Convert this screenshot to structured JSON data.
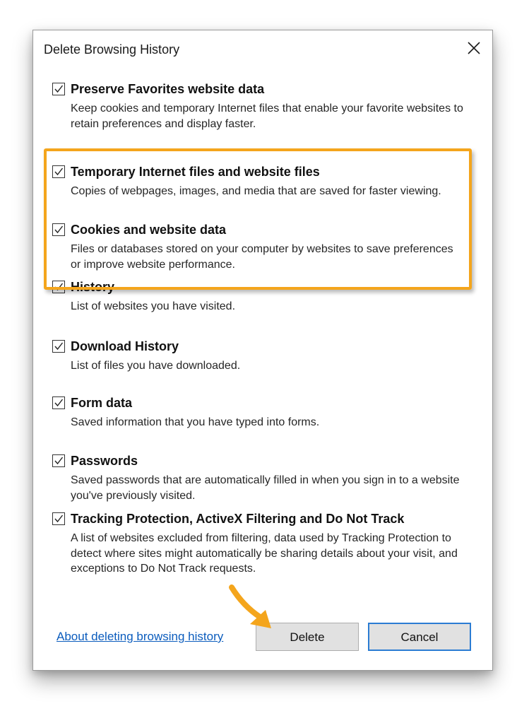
{
  "window": {
    "title": "Delete Browsing History",
    "close_icon": "close-icon"
  },
  "options": [
    {
      "key": "preserve-favorites",
      "label": "Preserve Favorites website data",
      "checked": true,
      "description": "Keep cookies and temporary Internet files that enable your favorite websites to retain preferences and display faster."
    },
    {
      "key": "temporary-internet-files",
      "label": "Temporary Internet files and website files",
      "checked": true,
      "description": "Copies of webpages, images, and media that are saved for faster viewing."
    },
    {
      "key": "cookies",
      "label": "Cookies and website data",
      "checked": true,
      "description": "Files or databases stored on your computer by websites to save preferences or improve website performance."
    },
    {
      "key": "history",
      "label": "History",
      "checked": true,
      "description": "List of websites you have visited."
    },
    {
      "key": "download-history",
      "label": "Download History",
      "checked": true,
      "description": "List of files you have downloaded."
    },
    {
      "key": "form-data",
      "label": "Form data",
      "checked": true,
      "description": "Saved information that you have typed into forms."
    },
    {
      "key": "passwords",
      "label": "Passwords",
      "checked": true,
      "description": "Saved passwords that are automatically filled in when you sign in to a website you've previously visited."
    },
    {
      "key": "tracking-protection",
      "label": "Tracking Protection, ActiveX Filtering and Do Not Track",
      "checked": true,
      "description": "A list of websites excluded from filtering, data used by Tracking Protection to detect where sites might automatically be sharing details about your visit, and exceptions to Do Not Track requests."
    }
  ],
  "footer": {
    "link_text": "About deleting browsing history",
    "delete_label": "Delete",
    "cancel_label": "Cancel"
  },
  "annotations": {
    "highlight_color": "#f4a51c",
    "arrow_color": "#f4a51c"
  },
  "colors": {
    "link": "#0b5cbd",
    "focus_border": "#2b7cd3"
  }
}
